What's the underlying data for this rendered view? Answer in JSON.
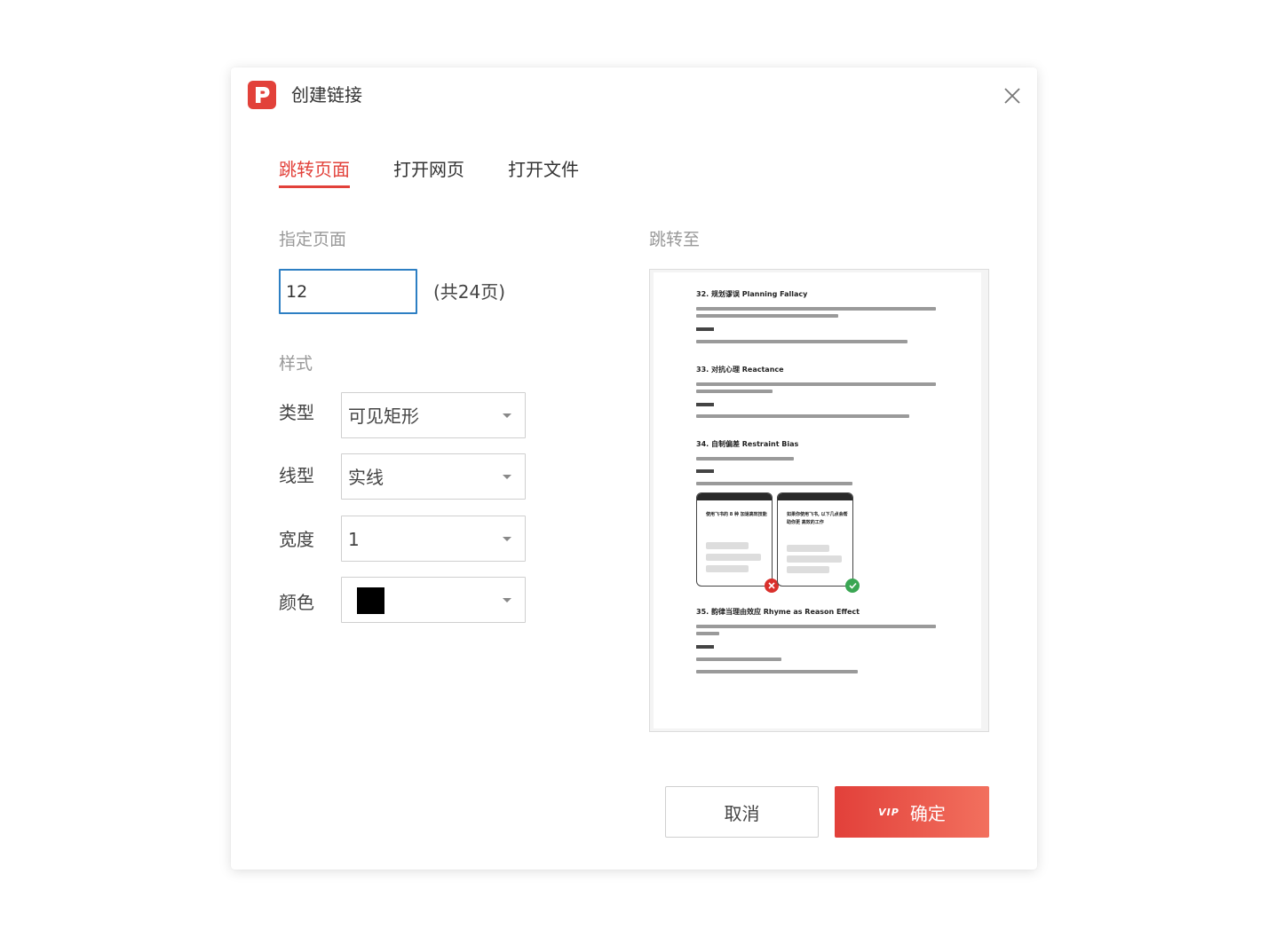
{
  "dialog": {
    "title": "创建链接",
    "app_icon": "p-logo-icon",
    "close_icon": "close-icon",
    "accent_color": "#e2413a"
  },
  "tabs": [
    {
      "label": "跳转页面",
      "active": true
    },
    {
      "label": "打开网页",
      "active": false
    },
    {
      "label": "打开文件",
      "active": false
    }
  ],
  "page_section": {
    "label": "指定页面",
    "value": "12",
    "total": "(共24页)"
  },
  "style_section": {
    "label": "样式",
    "type": {
      "label": "类型",
      "value": "可见矩形"
    },
    "line_type": {
      "label": "线型",
      "value": "实线"
    },
    "width": {
      "label": "宽度",
      "value": "1"
    },
    "color": {
      "label": "颜色",
      "value": "#000000"
    }
  },
  "preview": {
    "label": "跳转至",
    "headings": [
      "32. 规划谬误 Planning Fallacy",
      "33. 对抗心理 Reactance",
      "34. 自制偏差 Restraint Bias",
      "35. 韵律当理由效应 Rhyme as Reason Effect"
    ],
    "phone_left_text": "使用飞书的 8 种 加速高效技能",
    "phone_right_text": "如果你使用飞书, 以下几点会帮助你更 高效的工作"
  },
  "buttons": {
    "cancel": "取消",
    "vip": "VIP",
    "ok": "确定"
  }
}
